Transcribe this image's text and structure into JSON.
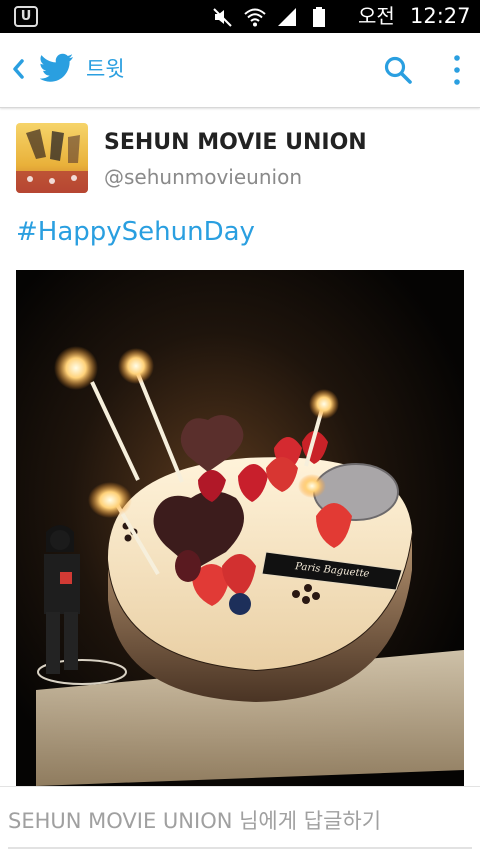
{
  "status_bar": {
    "ampm": "오전",
    "time": "12:27",
    "icons": [
      "app-notification-icon",
      "mute-icon",
      "wifi-icon",
      "signal-icon",
      "battery-icon"
    ]
  },
  "app_bar": {
    "title": "트윗",
    "icons": [
      "back-arrow-icon",
      "twitter-bird-icon",
      "search-icon",
      "more-vert-icon"
    ],
    "accent_color": "#2a9fe0"
  },
  "tweet": {
    "display_name": "SEHUN MOVIE UNION",
    "handle": "@sehunmovieunion",
    "text": "#HappySehunDay",
    "cake_plaque": "Paris Baguette"
  },
  "reply_box": {
    "placeholder": "SEHUN MOVIE UNION 님에게 답글하기"
  }
}
